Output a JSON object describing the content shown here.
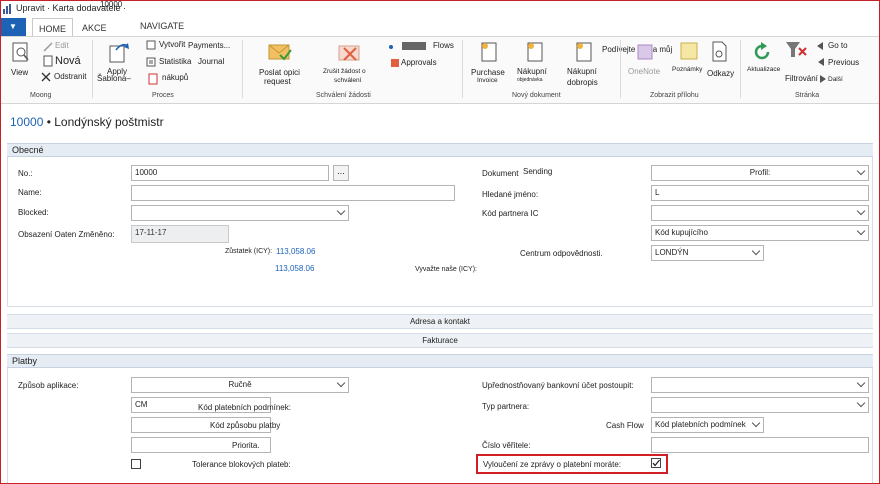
{
  "window": {
    "title": "Upravit · Karta dodavatele ·",
    "overlay": "10000"
  },
  "tabs": {
    "app": "▼",
    "home": "HOME",
    "akce": "AKCE",
    "navigate": "NAVIGATE"
  },
  "ribbon": {
    "view": "View",
    "edit": "Edit",
    "nova": "Nová",
    "odstranit": "Odstranit",
    "apply": "Apply",
    "sablona": "Šablona–",
    "vytvorit": "Vytvořit",
    "payments": "Payments...",
    "statistika": "Statistika",
    "journal": "Journal",
    "nakupu": "nákupů",
    "poslat1": "Poslat opici",
    "poslat2": "request",
    "zrusit1": "Zrušit žádost o",
    "zrusit2": "schválení",
    "flows": "Flows",
    "approvals": "Approvals",
    "purchase1": "Purchase",
    "purchase2": "Invoice",
    "nakupni1": "Nákupní",
    "nakupni1b": "objednávka",
    "nakupni2": "Nákupní",
    "nakupni2b": "dobropis",
    "podivejte": "Podívejte se na můj",
    "onenote": "OneNote",
    "poznamky": "Poznámky",
    "odkazy": "Odkazy",
    "aktualizace": "Aktualizace",
    "filtrovani": "Filtrování",
    "goto": "Go to",
    "previous": "Previous",
    "dalsi": "Další",
    "groups": {
      "g1": "Moong",
      "g2": "Proces",
      "g3": "Schválení žádosti",
      "g4": "Nový dokument",
      "g5": "Zobrazit přílohu",
      "g6": "Stránka"
    }
  },
  "record": {
    "no": "10000",
    "name": "• Londýnský poštmistr"
  },
  "obecne": {
    "header": "Obecné",
    "no_label": "No.:",
    "no_value": "10000",
    "dots": "...",
    "name_label": "Name:",
    "blocked_label": "Blocked:",
    "date_label": "Obsazení Oaten Změněno:",
    "date_value": "17-11-17",
    "zustatek_label": "Zůstatek (ICY):",
    "zustatek_value": "113,058.06",
    "value2": "113,058.06",
    "vyvazte_label": "Vyvažte naše (ICY):",
    "document_label": "Dokument",
    "sending": "Sending",
    "profil": "Profil:",
    "hledane_label": "Hledané jméno:",
    "hledane_value": "L",
    "kod_partnera_label": "Kód partnera IC",
    "kod_kupujiciho": "Kód kupujícího",
    "centrum_label": "Centrum odpovědnosti.",
    "centrum_value": "LONDÝN"
  },
  "bars": {
    "adresa": "Adresa a kontakt",
    "fakturace": "Fakturace"
  },
  "platby": {
    "header": "Platby",
    "zpusob_label": "Způsob aplikace:",
    "zpusob_value": "Ručně",
    "cm": "CM",
    "kod_platebnich": "Kód platebních podmínek:",
    "kod_zpusobu": "Kód způsobu platby",
    "priorita": "Priorita.",
    "tolerance": "Tolerance blokových plateb:",
    "upred_label": "Upřednostňovaný bankovní účet postoupit:",
    "typ_label": "Typ partnera:",
    "cashflow_label": "Cash Flow",
    "cashflow_value": "Kód platebních podmínek",
    "cislo_label": "Číslo věřitele:",
    "vylouceni_label": "Vyloučení ze zprávy o platební moráte:"
  }
}
